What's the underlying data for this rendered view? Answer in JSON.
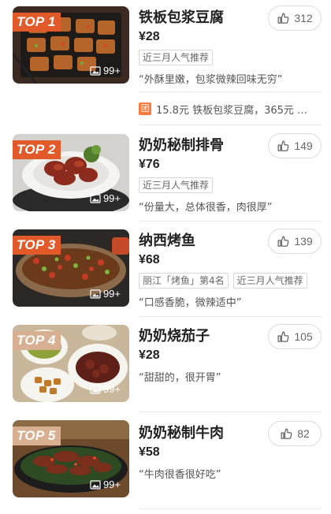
{
  "dishes": [
    {
      "rank": "TOP 1",
      "name": "铁板包浆豆腐",
      "price": "¥28",
      "tags": [
        "近三月人气推荐"
      ],
      "quote": "“外酥里嫩，包浆微辣回味无穷”",
      "likes": "312",
      "photos": "99+",
      "group_deal": {
        "badge": "团",
        "text": "15.8元 铁板包浆豆腐，365元 …"
      }
    },
    {
      "rank": "TOP 2",
      "name": "奶奶秘制排骨",
      "price": "¥76",
      "tags": [
        "近三月人气推荐"
      ],
      "quote": "“份量大，总体很香，肉很厚”",
      "likes": "149",
      "photos": "99+"
    },
    {
      "rank": "TOP 3",
      "name": "纳西烤鱼",
      "price": "¥68",
      "tags": [
        "丽江「烤鱼」第4名",
        "近三月人气推荐"
      ],
      "quote": "“口感香脆，微辣适中”",
      "likes": "139",
      "photos": "99+"
    },
    {
      "rank": "TOP 4",
      "name": "奶奶烧茄子",
      "price": "¥28",
      "tags": [],
      "quote": "“甜甜的，很开胃”",
      "likes": "105",
      "photos": "99+"
    },
    {
      "rank": "TOP 5",
      "name": "奶奶秘制牛肉",
      "price": "¥58",
      "tags": [],
      "quote": "“牛肉很香很好吃”",
      "likes": "82",
      "photos": "99+"
    }
  ],
  "icons": {
    "like": "thumbs-up-icon",
    "photo": "image-icon"
  },
  "colors": {
    "rank_top": "#e35a2a",
    "rank_low": "#d8b091",
    "group_badge": "#ff7a3d"
  }
}
